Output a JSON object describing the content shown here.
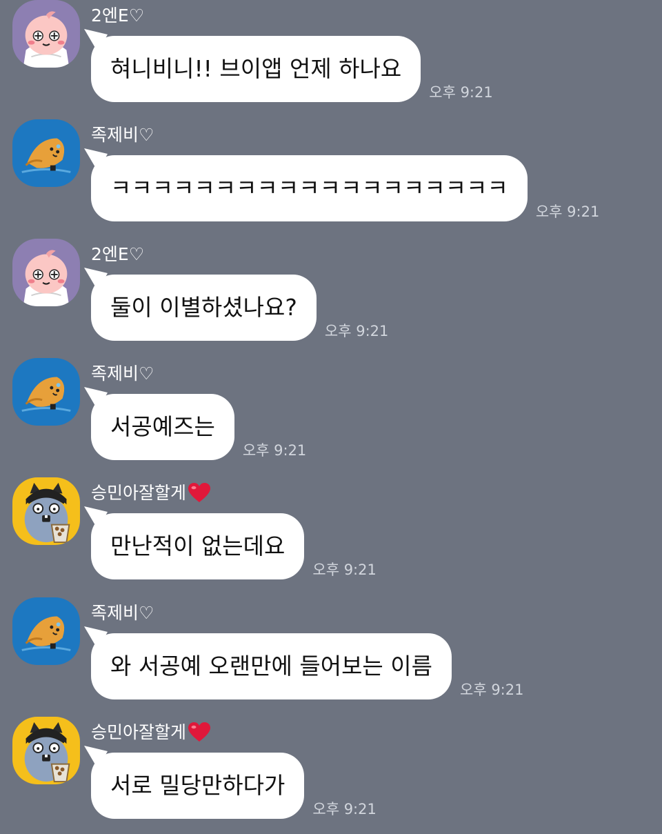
{
  "chat": {
    "messages": [
      {
        "sender": "2엔E♡",
        "sender_heart": false,
        "avatar": "peach-character-icon",
        "text": "혀니비니!! 브이앱 언제 하나요",
        "time": "오후 9:21"
      },
      {
        "sender": "족제비♡",
        "sender_heart": false,
        "avatar": "lion-character-icon",
        "text": "ㅋㅋㅋㅋㅋㅋㅋㅋㅋㅋㅋㅋㅋㅋㅋㅋㅋㅋㅋ",
        "time": "오후 9:21"
      },
      {
        "sender": "2엔E♡",
        "sender_heart": false,
        "avatar": "peach-character-icon",
        "text": "둘이 이별하셨나요?",
        "time": "오후 9:21"
      },
      {
        "sender": "족제비♡",
        "sender_heart": false,
        "avatar": "lion-character-icon",
        "text": "서공예즈는",
        "time": "오후 9:21"
      },
      {
        "sender": "승민아잘할게",
        "sender_heart": true,
        "avatar": "cat-character-icon",
        "text": "만난적이 없는데요",
        "time": "오후 9:21"
      },
      {
        "sender": "족제비♡",
        "sender_heart": false,
        "avatar": "lion-character-icon",
        "text": "와 서공예 오랜만에 들어보는 이름",
        "time": "오후 9:21"
      },
      {
        "sender": "승민아잘할게",
        "sender_heart": true,
        "avatar": "cat-character-icon",
        "text": "서로 밀당만하다가",
        "time": "오후 9:21"
      }
    ]
  },
  "colors": {
    "background": "#6d7380",
    "bubble": "#ffffff",
    "heart": "#e0183a"
  }
}
